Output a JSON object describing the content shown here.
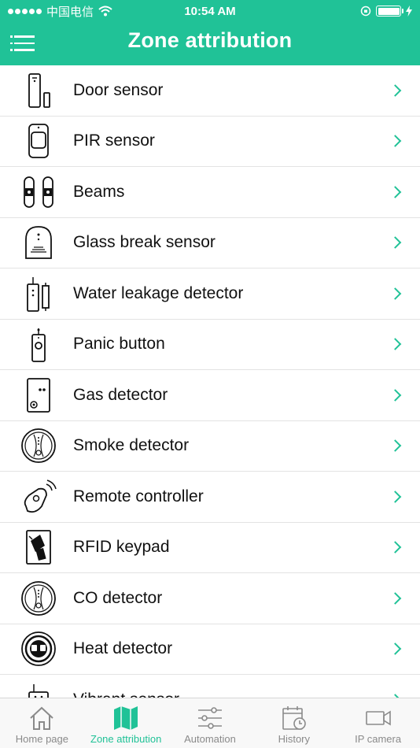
{
  "status_bar": {
    "carrier": "中国电信",
    "time": "10:54 AM"
  },
  "header": {
    "title": "Zone attribution"
  },
  "list": {
    "items": [
      {
        "label": "Door sensor",
        "icon": "door-sensor-icon"
      },
      {
        "label": "PIR sensor",
        "icon": "pir-sensor-icon"
      },
      {
        "label": "Beams",
        "icon": "beams-icon"
      },
      {
        "label": "Glass break sensor",
        "icon": "glass-break-icon"
      },
      {
        "label": "Water leakage detector",
        "icon": "water-leak-icon"
      },
      {
        "label": "Panic button",
        "icon": "panic-button-icon"
      },
      {
        "label": "Gas detector",
        "icon": "gas-detector-icon"
      },
      {
        "label": "Smoke detector",
        "icon": "smoke-detector-icon"
      },
      {
        "label": "Remote controller",
        "icon": "remote-controller-icon"
      },
      {
        "label": "RFID keypad",
        "icon": "rfid-keypad-icon"
      },
      {
        "label": "CO detector",
        "icon": "co-detector-icon"
      },
      {
        "label": "Heat detector",
        "icon": "heat-detector-icon"
      },
      {
        "label": "Vibrant sensor",
        "icon": "vibrant-sensor-icon"
      }
    ]
  },
  "tab_bar": {
    "tabs": [
      {
        "label": "Home page",
        "icon": "home-icon",
        "active": false
      },
      {
        "label": "Zone attribution",
        "icon": "map-icon",
        "active": true
      },
      {
        "label": "Automation",
        "icon": "sliders-icon",
        "active": false
      },
      {
        "label": "History",
        "icon": "calendar-clock-icon",
        "active": false
      },
      {
        "label": "IP camera",
        "icon": "video-camera-icon",
        "active": false
      }
    ]
  },
  "colors": {
    "accent": "#20c297",
    "tab_inactive": "#8a8a8a",
    "divider": "#e3e3e3"
  }
}
